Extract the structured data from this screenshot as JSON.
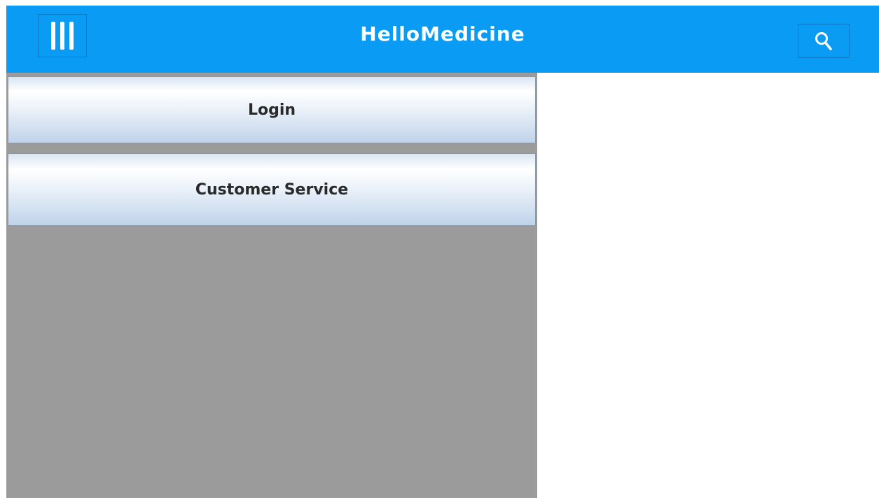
{
  "header": {
    "title": "HelloMedicine",
    "menu_icon": "hamburger-menu-icon",
    "search_icon": "search-icon",
    "background_color": "#0a9cf5"
  },
  "sidebar": {
    "background_color": "#9b9b9b",
    "items": [
      {
        "label": "Login"
      },
      {
        "label": "Customer Service"
      }
    ]
  }
}
